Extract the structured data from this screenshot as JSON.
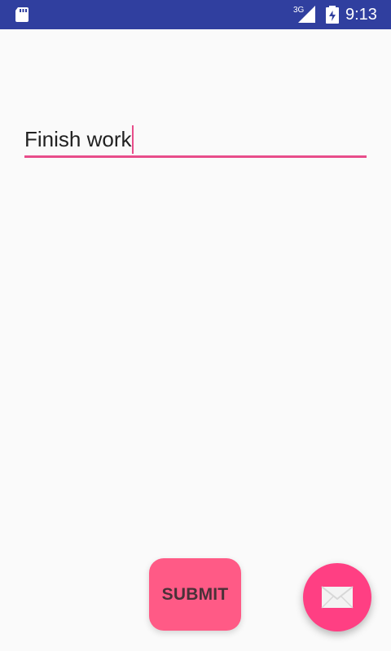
{
  "status_bar": {
    "network_type": "3G",
    "time": "9:13",
    "icons": [
      "sd-card-icon",
      "signal-icon",
      "battery-icon"
    ],
    "background_color": "#303f9f"
  },
  "task_input": {
    "value": "Finish work",
    "accent_color": "#e84d8a"
  },
  "buttons": {
    "submit_label": "SUBMIT",
    "submit_color": "#ff5a86",
    "fab_icon": "email-icon",
    "fab_color": "#ff3f83"
  }
}
